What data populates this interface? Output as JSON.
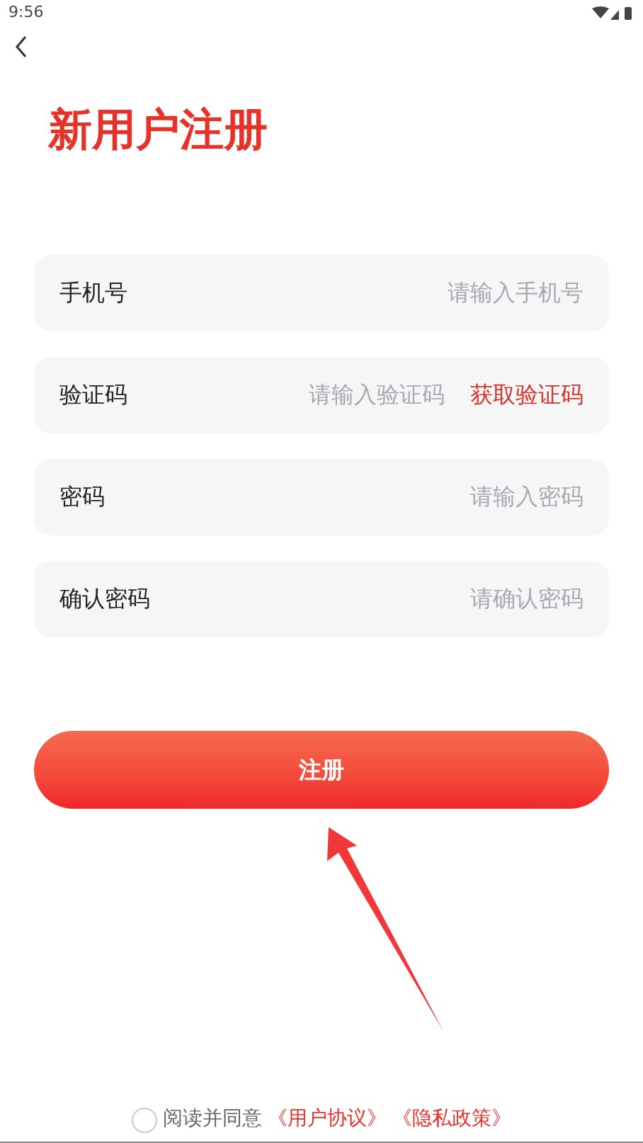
{
  "status_bar": {
    "time": "9:56"
  },
  "title": "新用户注册",
  "fields": [
    {
      "kind": "input",
      "label": "手机号",
      "placeholder": "请输入手机号"
    },
    {
      "kind": "code",
      "label": "验证码",
      "placeholder": "请输入验证码",
      "action": "获取验证码"
    },
    {
      "kind": "input",
      "label": "密码",
      "placeholder": "请输入密码"
    },
    {
      "kind": "input",
      "label": "确认密码",
      "placeholder": "请确认密码"
    }
  ],
  "submit_button": "注册",
  "agreement": {
    "checked": false,
    "text": "阅读并同意",
    "links": [
      "《用户协议》",
      "《隐私政策》"
    ]
  }
}
